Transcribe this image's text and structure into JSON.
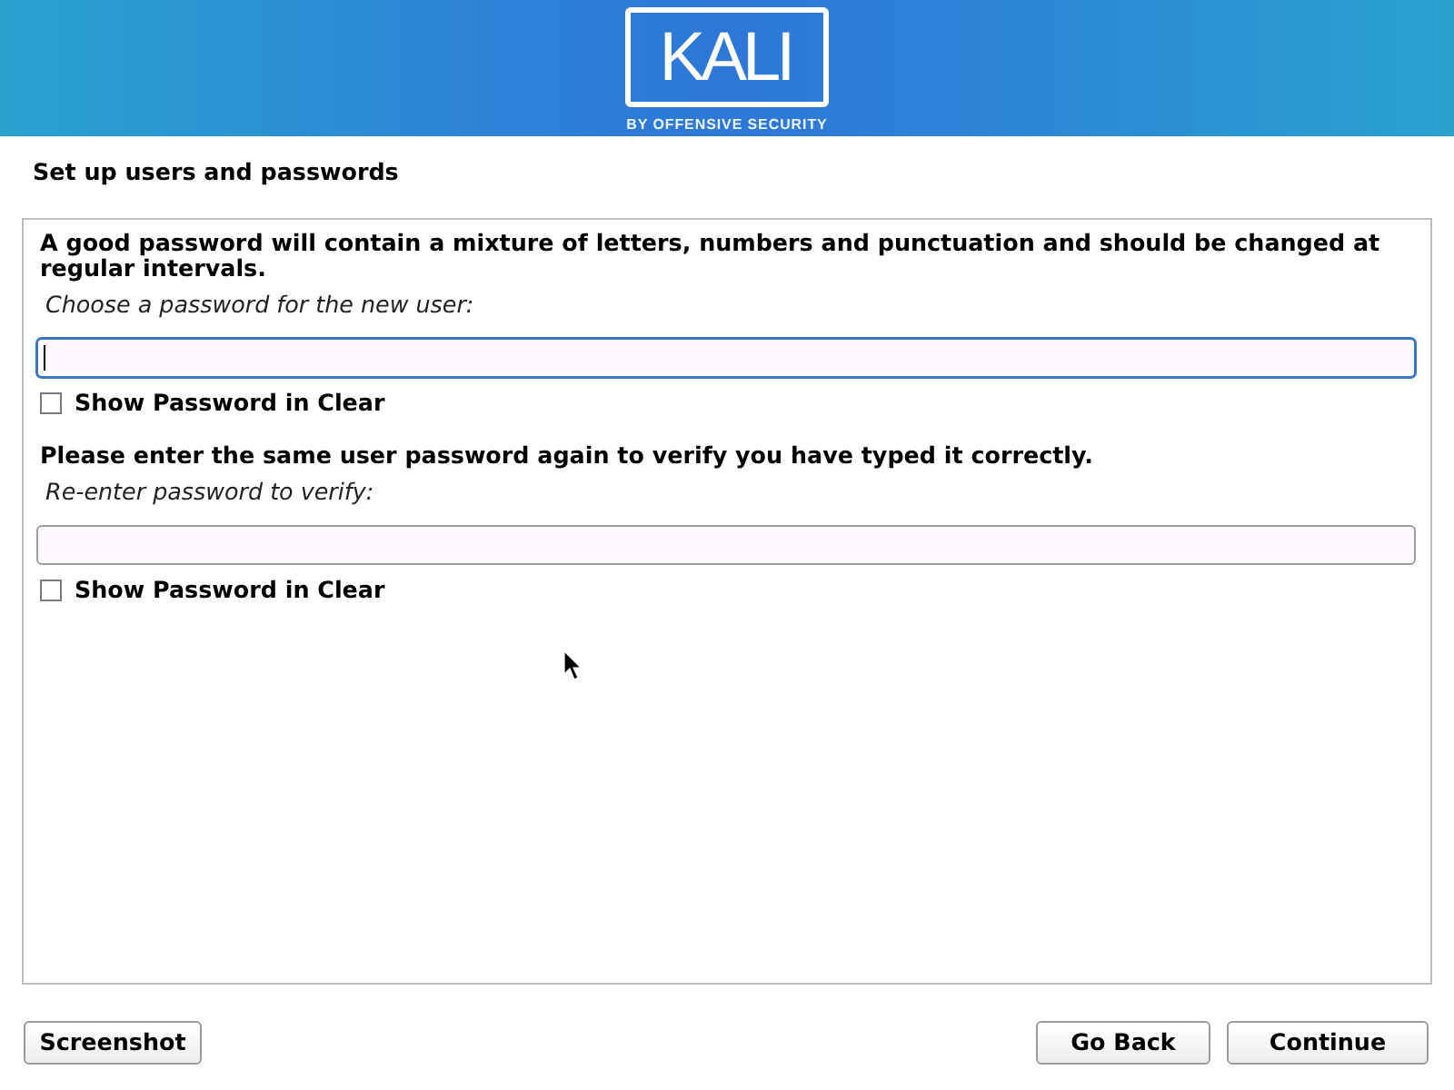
{
  "header": {
    "logo_text": "KALI",
    "logo_tagline": "BY OFFENSIVE SECURITY"
  },
  "page_title": "Set up users and passwords",
  "form": [
    {
      "kind": "paragraph",
      "text": "A good password will contain a mixture of letters, numbers and punctuation and should be changed at regular intervals."
    },
    {
      "kind": "prompt",
      "text": "Choose a password for the new user:"
    },
    {
      "kind": "password",
      "focused": true
    },
    {
      "kind": "checkbox",
      "label": "Show Password in Clear",
      "checked": false
    },
    {
      "kind": "paragraph",
      "text": "Please enter the same user password again to verify you have typed it correctly."
    },
    {
      "kind": "prompt",
      "text": "Re-enter password to verify:"
    },
    {
      "kind": "password",
      "focused": false
    },
    {
      "kind": "checkbox",
      "label": "Show Password in Clear",
      "checked": false
    }
  ],
  "buttons": {
    "left": [
      "Screenshot"
    ],
    "right": [
      "Go Back",
      "Continue"
    ]
  }
}
